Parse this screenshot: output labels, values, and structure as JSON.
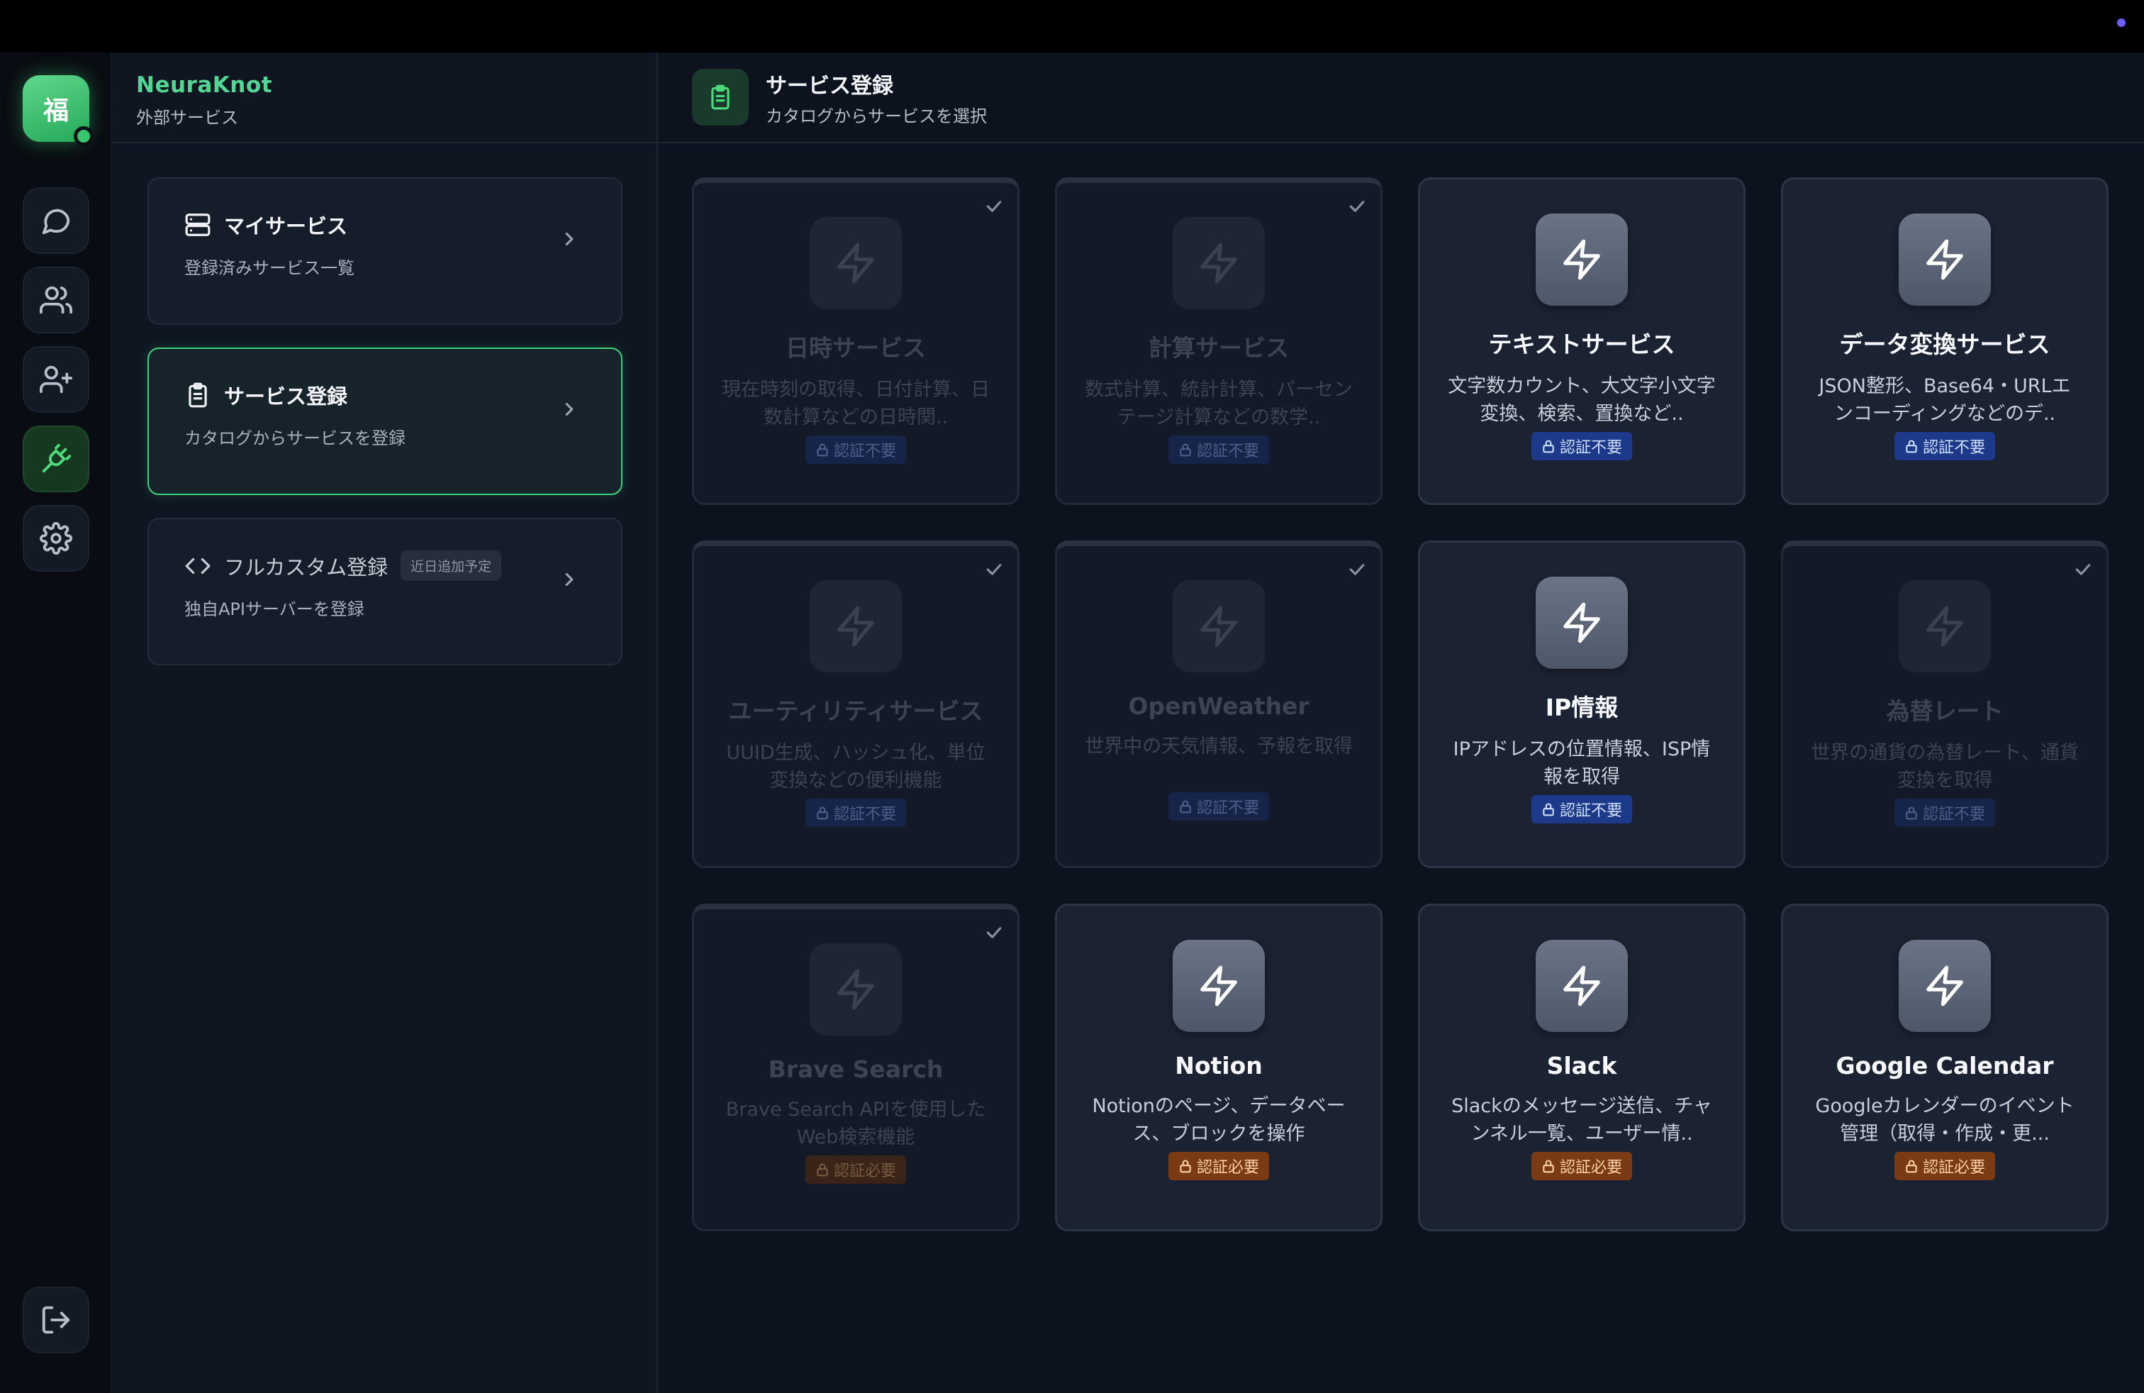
{
  "app": {
    "avatar_char": "福",
    "brand": "NeuraKnot",
    "section": "外部サービス"
  },
  "rail": {
    "items": [
      {
        "name": "chat",
        "icon": "chat-icon"
      },
      {
        "name": "users",
        "icon": "users-icon"
      },
      {
        "name": "add-user",
        "icon": "user-plus-icon"
      },
      {
        "name": "plug",
        "icon": "plug-icon",
        "active": true
      },
      {
        "name": "settings",
        "icon": "gear-icon"
      }
    ],
    "logout_icon": "logout-icon"
  },
  "menu": [
    {
      "title": "マイサービス",
      "desc": "登録済みサービス一覧",
      "icon": "server-icon"
    },
    {
      "title": "サービス登録",
      "desc": "カタログからサービスを登録",
      "icon": "clipboard-icon",
      "active": true
    },
    {
      "title": "フルカスタム登録",
      "desc": "独自APIサーバーを登録",
      "icon": "code-icon",
      "badge": "近日追加予定"
    }
  ],
  "main": {
    "title": "サービス登録",
    "subtitle": "カタログからサービスを選択"
  },
  "services": [
    {
      "name": "日時サービス",
      "desc": "現在時刻の取得、日付計算、日数計算などの日時関..",
      "auth": "認証不要",
      "registered": true
    },
    {
      "name": "計算サービス",
      "desc": "数式計算、統計計算、パーセンテージ計算などの数学..",
      "auth": "認証不要",
      "registered": true
    },
    {
      "name": "テキストサービス",
      "desc": "文字数カウント、大文字小文字変換、検索、置換など..",
      "auth": "認証不要",
      "registered": false
    },
    {
      "name": "データ変換サービス",
      "desc": "JSON整形、Base64・URLエンコーディングなどのデ..",
      "auth": "認証不要",
      "registered": false
    },
    {
      "name": "ユーティリティサービス",
      "desc": "UUID生成、ハッシュ化、単位変換などの便利機能",
      "auth": "認証不要",
      "registered": true
    },
    {
      "name": "OpenWeather",
      "desc": "世界中の天気情報、予報を取得",
      "auth": "認証不要",
      "registered": true
    },
    {
      "name": "IP情報",
      "desc": "IPアドレスの位置情報、ISP情報を取得",
      "auth": "認証不要",
      "registered": false
    },
    {
      "name": "為替レート",
      "desc": "世界の通貨の為替レート、通貨変換を取得",
      "auth": "認証不要",
      "registered": true
    },
    {
      "name": "Brave Search",
      "desc": "Brave Search APIを使用したWeb検索機能",
      "auth": "認証必要",
      "registered": true
    },
    {
      "name": "Notion",
      "desc": "Notionのページ、データベース、ブロックを操作",
      "auth": "認証必要",
      "registered": false
    },
    {
      "name": "Slack",
      "desc": "Slackのメッセージ送信、チャンネル一覧、ユーザー情..",
      "auth": "認証必要",
      "registered": false
    },
    {
      "name": "Google Calendar",
      "desc": "Googleカレンダーのイベント管理（取得・作成・更...",
      "auth": "認証必要",
      "registered": false
    }
  ],
  "colors": {
    "accent": "#3fd07a",
    "auth_free": "#1d3a8a",
    "auth_required": "#7a3a14"
  }
}
